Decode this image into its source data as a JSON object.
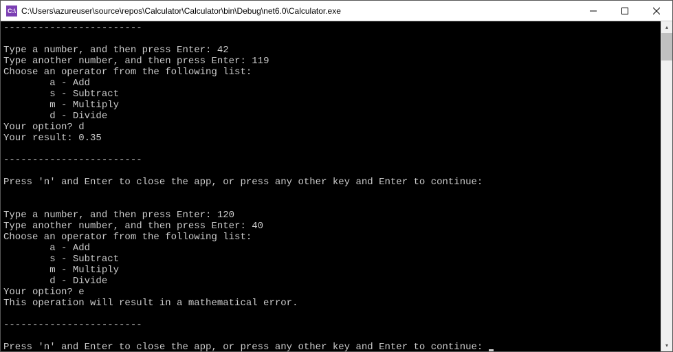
{
  "window": {
    "icon_text": "C:\\",
    "title": "C:\\Users\\azureuser\\source\\repos\\Calculator\\Calculator\\bin\\Debug\\net6.0\\Calculator.exe"
  },
  "console": {
    "separator": "------------------------",
    "session1": {
      "prompt_num1": "Type a number, and then press Enter: ",
      "input_num1": "42",
      "prompt_num2": "Type another number, and then press Enter: ",
      "input_num2": "119",
      "choose_operator": "Choose an operator from the following list:",
      "opt_a": "        a - Add",
      "opt_s": "        s - Subtract",
      "opt_m": "        m - Multiply",
      "opt_d": "        d - Divide",
      "option_prompt": "Your option? ",
      "option_value": "d",
      "result_label": "Your result: ",
      "result_value": "0.35"
    },
    "continue_prompt": "Press 'n' and Enter to close the app, or press any other key and Enter to continue: ",
    "session2": {
      "prompt_num1": "Type a number, and then press Enter: ",
      "input_num1": "120",
      "prompt_num2": "Type another number, and then press Enter: ",
      "input_num2": "40",
      "choose_operator": "Choose an operator from the following list:",
      "opt_a": "        a - Add",
      "opt_s": "        s - Subtract",
      "opt_m": "        m - Multiply",
      "opt_d": "        d - Divide",
      "option_prompt": "Your option? ",
      "option_value": "e",
      "error_msg": "This operation will result in a mathematical error."
    }
  }
}
